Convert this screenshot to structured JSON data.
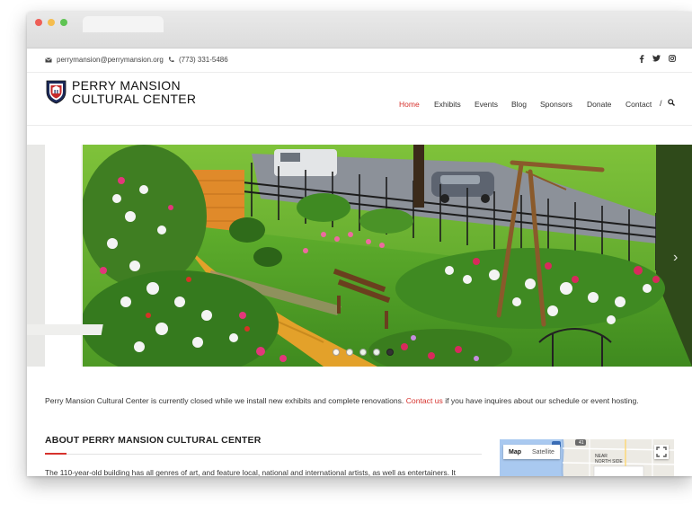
{
  "topbar": {
    "email": "perrymansion@perrymansion.org",
    "phone": "(773) 331-5486",
    "social_icons": [
      "facebook-icon",
      "twitter-icon",
      "instagram-icon"
    ]
  },
  "brand": {
    "line1": "PERRY MANSION",
    "line2": "CULTURAL CENTER"
  },
  "nav": {
    "items": [
      "Home",
      "Exhibits",
      "Events",
      "Blog",
      "Sponsors",
      "Donate",
      "Contact"
    ],
    "active": "Home",
    "separator": "/"
  },
  "hero": {
    "slide_count": 5,
    "active_slide": 5
  },
  "notice": {
    "before": "Perry Mansion Cultural Center is currently closed while we install new exhibits and complete renovations.",
    "link": "Contact us",
    "after": "if you have inquires about our schedule or event hosting."
  },
  "about": {
    "title": "ABOUT PERRY MANSION CULTURAL CENTER",
    "text": "The 110-year-old building has all genres of art, and feature local, national and international artists, as well as entertainers. It"
  },
  "map": {
    "tab_map": "Map",
    "tab_satellite": "Satellite",
    "label_near": "NEAR",
    "label_north_side": "NORTH SIDE",
    "route": "41"
  },
  "colors": {
    "accent": "#d6322d",
    "text": "#222222"
  }
}
